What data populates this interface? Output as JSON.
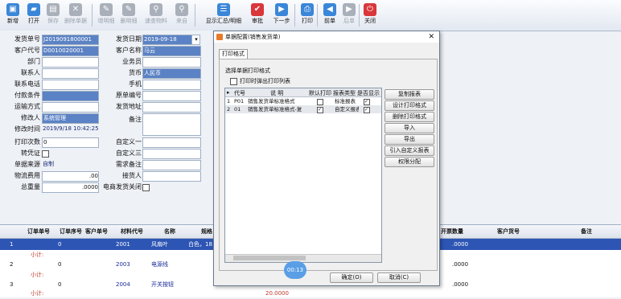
{
  "toolbar": {
    "new": "新增",
    "open": "打开",
    "save": "保存",
    "delete": "删除单据",
    "add_detail": "增明细",
    "del_detail": "删明细",
    "quick_material": "速查物料",
    "review": "来自",
    "summary": "显示汇总/明细",
    "approve": "审批",
    "next_step": "下一步",
    "print": "打印",
    "prev_doc": "前单",
    "next_doc": "后单",
    "close": "关闭"
  },
  "form": {
    "ship_no_label": "发货单号",
    "ship_no": "J2019091800001",
    "ship_date_label": "发货日期",
    "ship_date": "2019-09-18",
    "cust_code_label": "客户代号",
    "cust_code": "D0010020001",
    "cust_name_label": "客户名称",
    "cust_name": "马云",
    "dept_label": "部门",
    "salesman_label": "业务员",
    "contact_label": "联系人",
    "currency_label": "货币",
    "currency": "人民币",
    "phone_label": "联系电话",
    "mobile_label": "手机",
    "payment_label": "付款条件",
    "orig_order_label": "原单编号",
    "transport_label": "运输方式",
    "ship_addr_label": "发货地址",
    "modifier_label": "修改人",
    "modifier": "系统管理",
    "remark_label": "备注",
    "modify_time_label": "修改时间",
    "modify_time": "2019/9/18 10:42:25",
    "print_count_label": "打印次数",
    "print_count": "0",
    "custom1_label": "自定义一",
    "voucher_label": "转凭证",
    "custom3_label": "自定义三",
    "source_label": "单据来源",
    "source": "自制",
    "demand_remark_label": "需求备注",
    "freight_label": "物流费用",
    "freight": ".00",
    "receiver_label": "接货人",
    "total_weight_label": "总重量",
    "total_weight": ".0000",
    "ecom_close_label": "电商发货关闭"
  },
  "grid": {
    "headers": {
      "order_no": "订单单号",
      "order_seq": "订单序号",
      "cust_order": "客户单号",
      "material": "材料代号",
      "name": "名称",
      "spec": "规格",
      "open_invoice": "开票数量",
      "cust_goods": "客户货号",
      "remark": "备注"
    },
    "rows": [
      {
        "idx": "1",
        "seq": "0",
        "material": "2001",
        "name": "风扇叶",
        "spec": "白色，18",
        "inv": ".0000"
      },
      {
        "idx": "2",
        "seq": "0",
        "material": "2003",
        "name": "电源线",
        "inv": ".0000"
      },
      {
        "idx": "3",
        "seq": "0",
        "material": "2004",
        "name": "开关按钮",
        "inv": ".0000"
      }
    ],
    "subtotal": "小计:",
    "bottom_value": "20.0000"
  },
  "dialog": {
    "title": "单据配置(销售发货单)",
    "tab": "打印格式",
    "section": "选择单据打印格式",
    "print_popup_label": "打印时弹出打印列表",
    "columns": {
      "code": "代号",
      "desc": "说  明",
      "default": "默认打印",
      "type": "报表类型",
      "show": "是否显示"
    },
    "rows": [
      {
        "idx": "1",
        "code": "P01",
        "desc": "销售发货单标准格式",
        "type": "标准报表"
      },
      {
        "idx": "2",
        "code": "01",
        "desc": "销售发货单标准格式-复",
        "type": "自定义报表"
      }
    ],
    "side_buttons": [
      "复制报表",
      "设计打印格式",
      "删除打印格式",
      "导入",
      "导出",
      "引入自定义报表",
      "权限分配"
    ],
    "ok": "确定(O)",
    "cancel": "取消(C)",
    "close_glyph": "✕"
  },
  "timer_badge": "00:13",
  "colors": {
    "accent": "#2d55b4",
    "field_blue": "#5b82c4",
    "subtotal_red": "#c0392b"
  }
}
